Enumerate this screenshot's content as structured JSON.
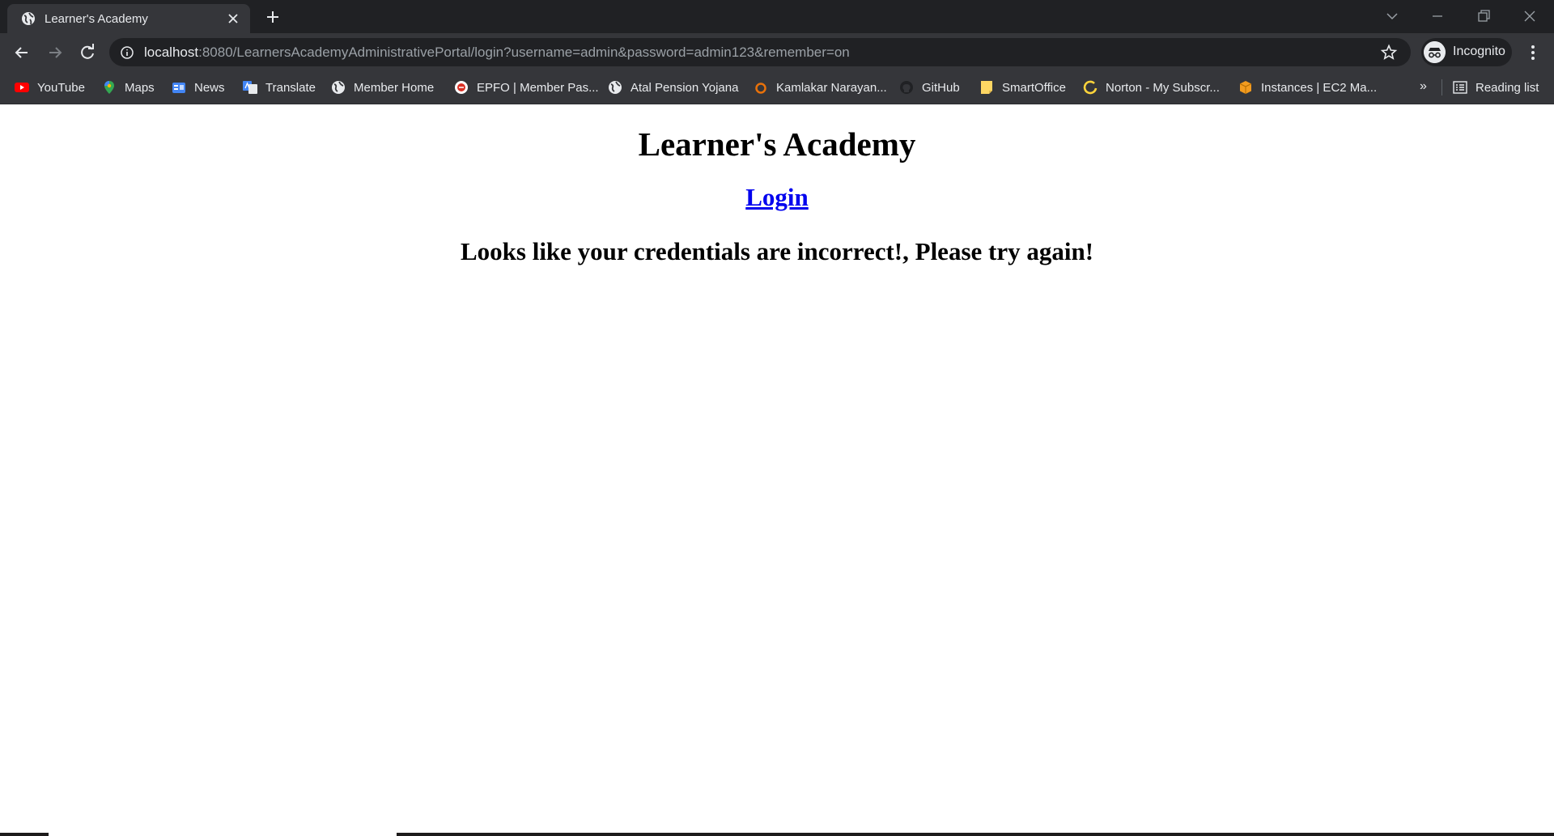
{
  "tab": {
    "title": "Learner's Academy"
  },
  "address_bar": {
    "host": "localhost",
    "path": ":8080/LearnersAcademyAdministrativePortal/login?username=admin&password=admin123&remember=on"
  },
  "profile": {
    "label": "Incognito"
  },
  "bookmarks": [
    {
      "label": "YouTube",
      "icon": "youtube-icon"
    },
    {
      "label": "Maps",
      "icon": "maps-icon"
    },
    {
      "label": "News",
      "icon": "news-icon"
    },
    {
      "label": "Translate",
      "icon": "translate-icon"
    },
    {
      "label": "Member Home",
      "icon": "globe-icon"
    },
    {
      "label": "EPFO | Member Pas...",
      "icon": "epfo-icon"
    },
    {
      "label": "Atal Pension Yojana",
      "icon": "globe-icon"
    },
    {
      "label": "Kamlakar Narayan...",
      "icon": "kamlakar-icon"
    },
    {
      "label": "GitHub",
      "icon": "github-icon"
    },
    {
      "label": "SmartOffice",
      "icon": "note-icon"
    },
    {
      "label": "Norton - My Subscr...",
      "icon": "norton-icon"
    },
    {
      "label": "Instances | EC2 Ma...",
      "icon": "aws-box-icon"
    }
  ],
  "bookmarks_more": "»",
  "reading_list": {
    "label": "Reading list"
  },
  "page": {
    "heading": "Learner's Academy",
    "login_link": "Login",
    "error_message": "Looks like your credentials are incorrect!, Please try again!"
  },
  "colors": {
    "link": "#0000ee",
    "chrome_dark": "#202124",
    "chrome_toolbar": "#35363a"
  }
}
